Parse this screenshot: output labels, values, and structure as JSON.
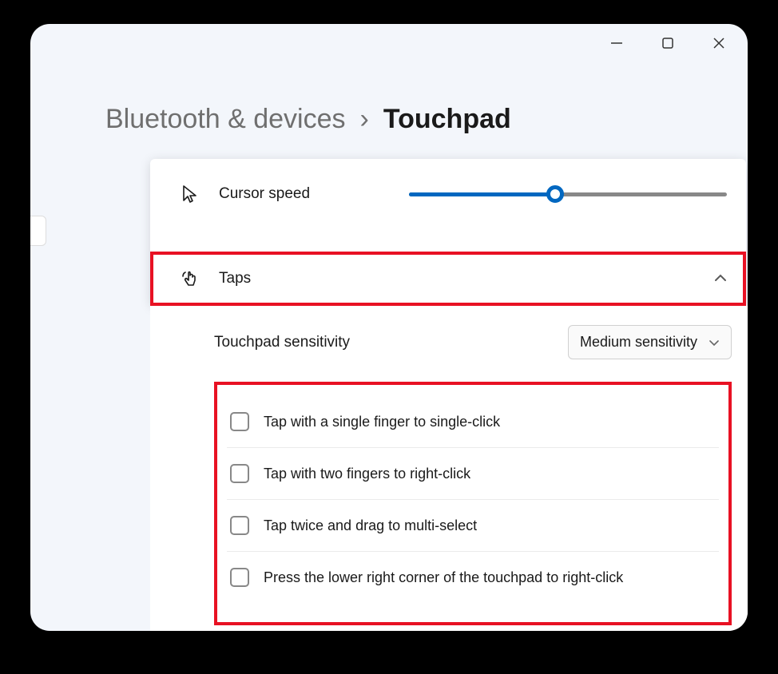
{
  "breadcrumb": {
    "parent": "Bluetooth & devices",
    "separator": "›",
    "current": "Touchpad"
  },
  "cursorSpeed": {
    "label": "Cursor speed"
  },
  "taps": {
    "label": "Taps"
  },
  "sensitivity": {
    "label": "Touchpad sensitivity",
    "value": "Medium sensitivity"
  },
  "options": [
    {
      "label": "Tap with a single finger to single-click"
    },
    {
      "label": "Tap with two fingers to right-click"
    },
    {
      "label": "Tap twice and drag to multi-select"
    },
    {
      "label": "Press the lower right corner of the touchpad to right-click"
    }
  ]
}
